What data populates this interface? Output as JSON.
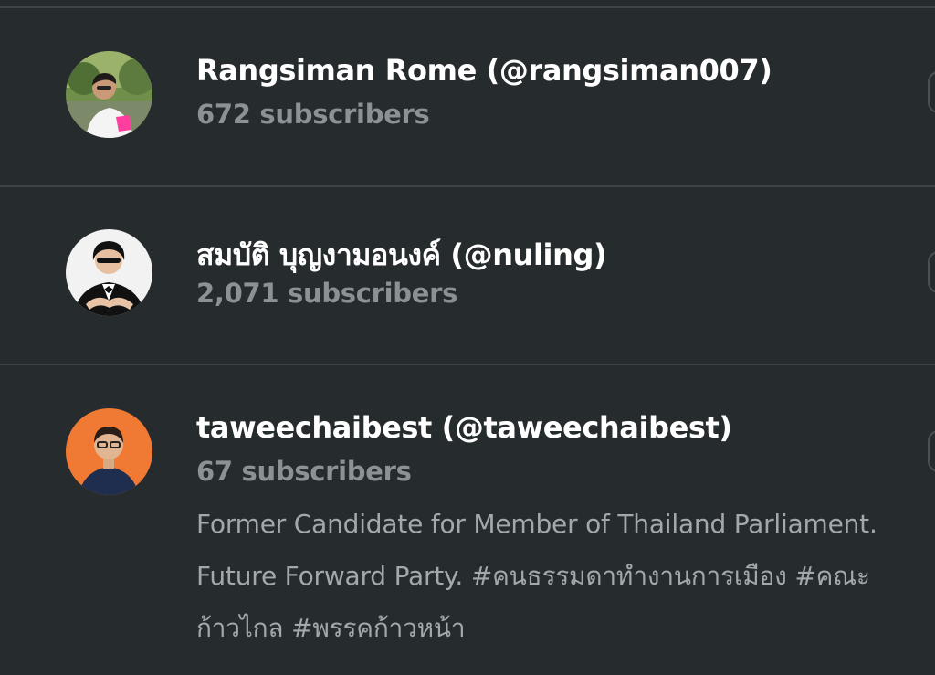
{
  "channels": [
    {
      "name": "Rangsiman Rome (@rangsiman007)",
      "subscribers": "672 subscribers",
      "avatar_icon": "user-photo-outdoor-pink-shirt"
    },
    {
      "name": "สมบัติ บุญงามอนงค์ (@nuling)",
      "subscribers": "2,071 subscribers",
      "avatar_icon": "user-photo-sunglasses-suit"
    },
    {
      "name": "taweechaibest (@taweechaibest)",
      "subscribers": "67 subscribers",
      "avatar_icon": "user-photo-orange-background",
      "description_lines": [
        "Former Candidate for Member of Thailand Parliament.",
        "Future Forward Party. #คนธรรมดาทำงานการเมือง #คณะ",
        "ก้าวไกล #พรรคก้าวหน้า"
      ]
    }
  ],
  "colors": {
    "background": "#262b2e",
    "divider": "#3d4448",
    "name_text": "#ffffff",
    "subscribers_text": "#8c9196",
    "description_text": "#a3a8ad"
  }
}
